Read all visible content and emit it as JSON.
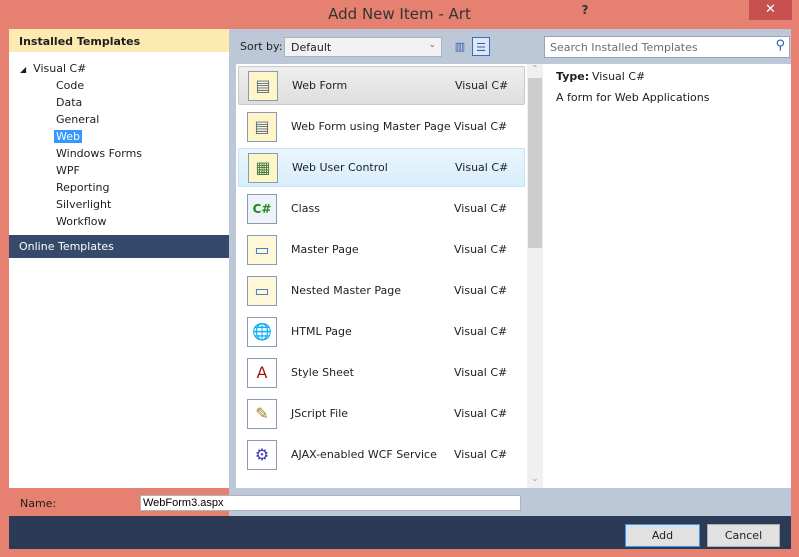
{
  "window": {
    "title": "Add New Item - Art",
    "help": "?",
    "close": "✕"
  },
  "sidebar": {
    "header": "Installed Templates",
    "root": "Visual C#",
    "children": [
      "Code",
      "Data",
      "General",
      "Web",
      "Windows Forms",
      "WPF",
      "Reporting",
      "Silverlight",
      "Workflow"
    ],
    "selected": "Web",
    "online": "Online Templates"
  },
  "toolbar": {
    "sort_label": "Sort by:",
    "sort_value": "Default",
    "search_placeholder": "Search Installed Templates"
  },
  "items": [
    {
      "name": "Web Form",
      "lang": "Visual C#",
      "icon": "web-form-icon"
    },
    {
      "name": "Web Form using Master Page",
      "lang": "Visual C#",
      "icon": "web-form-icon"
    },
    {
      "name": "Web User Control",
      "lang": "Visual C#",
      "icon": "user-control-icon"
    },
    {
      "name": "Class",
      "lang": "Visual C#",
      "icon": "csharp-class-icon"
    },
    {
      "name": "Master Page",
      "lang": "Visual C#",
      "icon": "master-page-icon"
    },
    {
      "name": "Nested Master Page",
      "lang": "Visual C#",
      "icon": "master-page-icon"
    },
    {
      "name": "HTML Page",
      "lang": "Visual C#",
      "icon": "html-page-icon"
    },
    {
      "name": "Style Sheet",
      "lang": "Visual C#",
      "icon": "style-sheet-icon"
    },
    {
      "name": "JScript File",
      "lang": "Visual C#",
      "icon": "script-icon"
    },
    {
      "name": "AJAX-enabled WCF Service",
      "lang": "Visual C#",
      "icon": "wcf-service-icon"
    }
  ],
  "details": {
    "type_label": "Type:",
    "type_value": "Visual C#",
    "description": "A form for Web Applications"
  },
  "name_field": {
    "label": "Name:",
    "value": "WebForm3.aspx"
  },
  "buttons": {
    "add": "Add",
    "cancel": "Cancel"
  }
}
